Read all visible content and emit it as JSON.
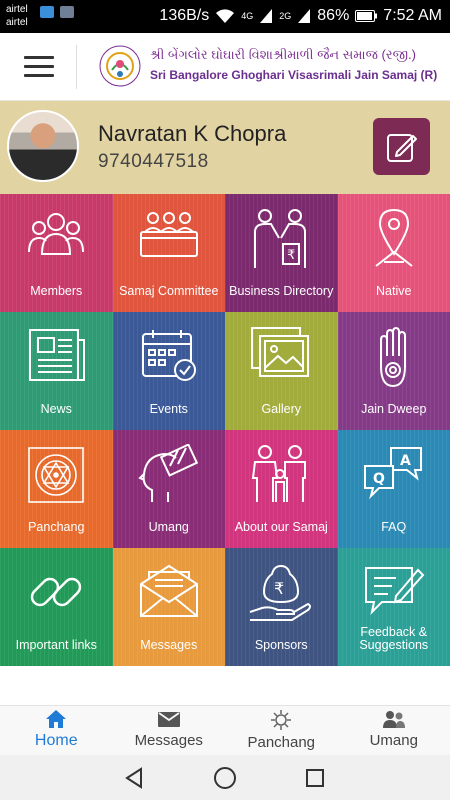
{
  "status_bar": {
    "carrier1": "airtel",
    "carrier2": "airtel",
    "speed": "136B/s",
    "net1": "4G",
    "net2": "2G",
    "battery": "86%",
    "time": "7:52 AM"
  },
  "header": {
    "title_gujarati": "શ્રી બેંગલોર ઘોઘારી વિશાશ્રીમાળી જૈન સમાજ (રજી.)",
    "title_english": "Sri Bangalore Ghoghari Visasrimali Jain Samaj (R)",
    "logo_icon": "samaj-logo-icon",
    "menu_icon": "hamburger-menu-icon"
  },
  "profile": {
    "name": "Navratan K Chopra",
    "phone": "9740447518",
    "edit_icon": "edit-pencil-icon"
  },
  "tiles": [
    {
      "label": "Members",
      "color": "#c8396a",
      "icon": "members-icon"
    },
    {
      "label": "Samaj Committee",
      "color": "#e0553e",
      "icon": "committee-icon"
    },
    {
      "label": "Business Directory",
      "color": "#7b2a6e",
      "icon": "business-icon"
    },
    {
      "label": "Native",
      "color": "#e6537a",
      "icon": "location-pin-icon"
    },
    {
      "label": "News",
      "color": "#2e9b75",
      "icon": "newspaper-icon"
    },
    {
      "label": "Events",
      "color": "#3b5996",
      "icon": "calendar-icon"
    },
    {
      "label": "Gallery",
      "color": "#a2ac3d",
      "icon": "gallery-icon"
    },
    {
      "label": "Jain Dweep",
      "color": "#853a87",
      "icon": "jain-hand-icon"
    },
    {
      "label": "Panchang",
      "color": "#e86a2a",
      "icon": "yantra-icon"
    },
    {
      "label": "Umang",
      "color": "#8a2d77",
      "icon": "umang-head-icon"
    },
    {
      "label": "About our Samaj",
      "color": "#d1357d",
      "icon": "family-icon"
    },
    {
      "label": "FAQ",
      "color": "#2a8ab5",
      "icon": "faq-icon"
    },
    {
      "label": "Important links",
      "color": "#219a58",
      "icon": "link-icon"
    },
    {
      "label": "Messages",
      "color": "#e79a3e",
      "icon": "envelope-icon"
    },
    {
      "label": "Sponsors",
      "color": "#3f5480",
      "icon": "sponsor-icon"
    },
    {
      "label": "Feedback & Suggestions",
      "color": "#2aa097",
      "icon": "feedback-icon"
    }
  ],
  "bottom_nav": [
    {
      "label": "Home",
      "icon": "home-icon",
      "active": true
    },
    {
      "label": "Messages",
      "icon": "mail-icon",
      "active": false
    },
    {
      "label": "Panchang",
      "icon": "panchang-icon",
      "active": false
    },
    {
      "label": "Umang",
      "icon": "umang-icon",
      "active": false
    }
  ],
  "colors": {
    "accent": "#1f7bd6",
    "profile_bg": "#e2d3a3",
    "edit_button": "#7d2b54",
    "header_title": "#7b2c91"
  }
}
